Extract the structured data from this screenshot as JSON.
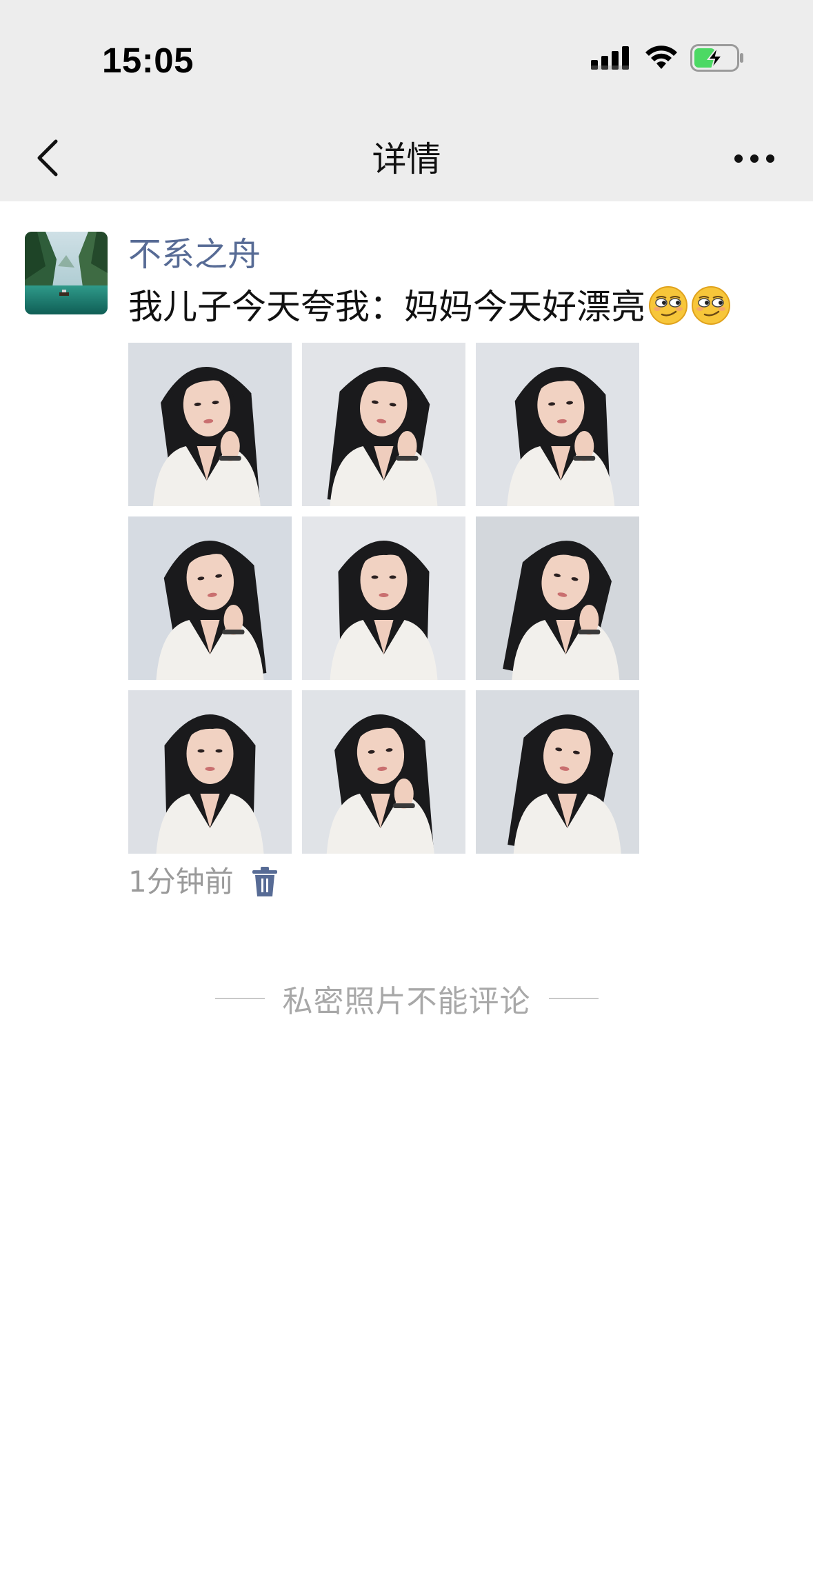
{
  "status_bar": {
    "time": "15:05",
    "icons": [
      "signal-icon",
      "wifi-icon",
      "battery-charging-icon"
    ],
    "battery_color": "#4cd964"
  },
  "nav": {
    "title": "详情",
    "back_icon": "chevron-left-icon",
    "more_icon": "more-dots-icon"
  },
  "post": {
    "author": "不系之舟",
    "text": "我儿子今天夸我：妈妈今天好漂亮",
    "emojis": [
      "smirk-emoji",
      "smirk-emoji"
    ],
    "photo_count": 9,
    "time": "1分钟前",
    "delete_icon": "trash-icon"
  },
  "comments": {
    "notice": "私密照片不能评论"
  },
  "colors": {
    "header_bg": "#ededed",
    "link_blue": "#576b95",
    "muted_text": "#9a9a9a"
  }
}
